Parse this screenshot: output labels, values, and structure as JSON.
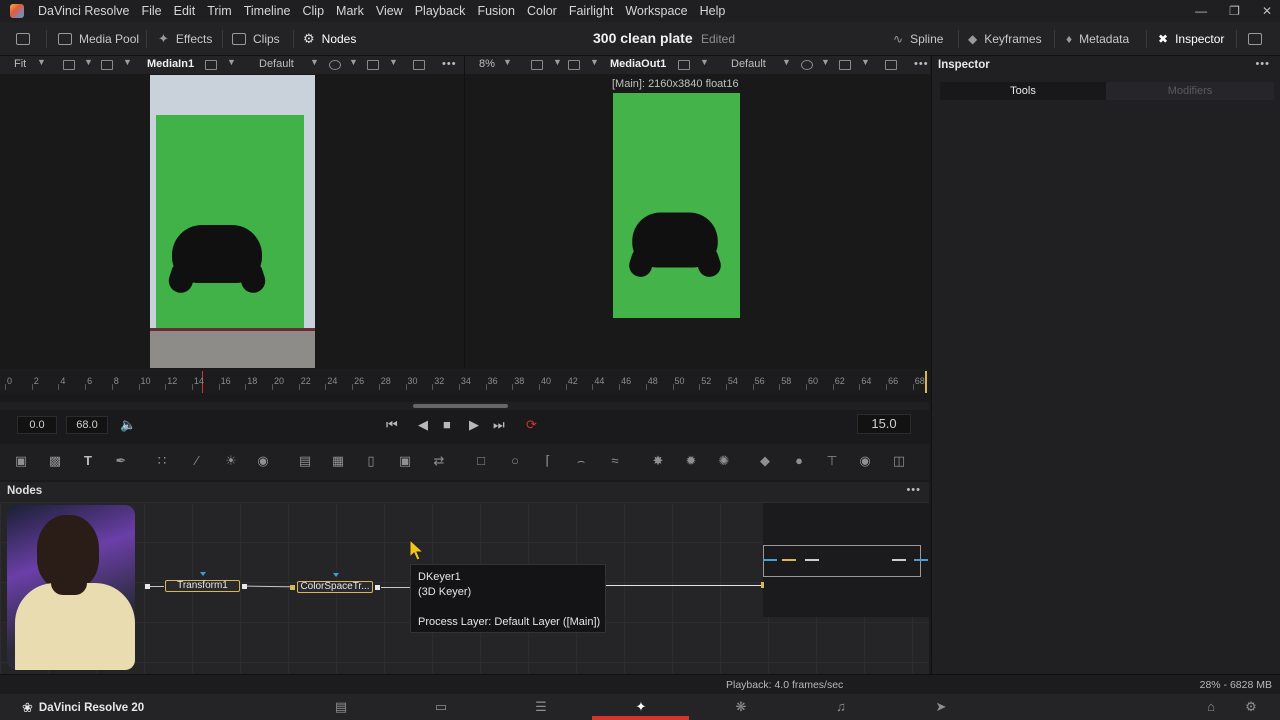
{
  "menubar": {
    "app_name": "DaVinci Resolve",
    "items": [
      "File",
      "Edit",
      "Trim",
      "Timeline",
      "Clip",
      "Mark",
      "View",
      "Playback",
      "Fusion",
      "Color",
      "Fairlight",
      "Workspace",
      "Help"
    ]
  },
  "toolbar": {
    "media_pool": "Media Pool",
    "effects": "Effects",
    "clips": "Clips",
    "nodes": "Nodes",
    "project_title": "300 clean plate",
    "project_status": "Edited",
    "spline": "Spline",
    "keyframes": "Keyframes",
    "metadata": "Metadata",
    "inspector": "Inspector"
  },
  "viewer_left": {
    "fit": "Fit",
    "name": "MediaIn1",
    "lut": "Default"
  },
  "viewer_right": {
    "zoom": "8%",
    "name": "MediaOut1",
    "lut": "Default",
    "info": "[Main]: 2160x3840 float16"
  },
  "inspector": {
    "title": "Inspector",
    "tabs": [
      "Tools",
      "Modifiers"
    ]
  },
  "ruler": {
    "ticks": [
      "0",
      "2",
      "4",
      "6",
      "8",
      "10",
      "12",
      "14",
      "16",
      "18",
      "20",
      "22",
      "24",
      "26",
      "28",
      "30",
      "32",
      "34",
      "36",
      "38",
      "40",
      "42",
      "44",
      "46",
      "48",
      "50",
      "52",
      "54",
      "56",
      "58",
      "60",
      "62",
      "64",
      "66",
      "68"
    ]
  },
  "transport": {
    "start": "0.0",
    "end": "68.0",
    "current": "15.0"
  },
  "nodes": {
    "title": "Nodes",
    "node1": "Transform1",
    "node2": "ColorSpaceTr...",
    "tooltip_name": "DKeyer1",
    "tooltip_type": "(3D Keyer)",
    "tooltip_layer": "Process Layer: Default Layer ([Main])"
  },
  "status": {
    "playback": "Playback: 4.0 frames/sec",
    "memory": "28% - 6828 MB"
  },
  "pagebar": {
    "brand": "DaVinci Resolve 20"
  },
  "colors": {
    "accent_red": "#d2352c",
    "node_border": "#d7b75a",
    "green_screen": "#41b247"
  }
}
